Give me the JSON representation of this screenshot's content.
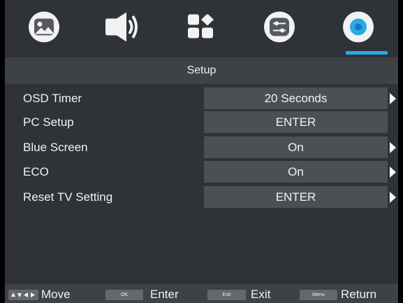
{
  "tabs": [
    {
      "name": "picture",
      "icon": "picture-icon"
    },
    {
      "name": "sound",
      "icon": "speaker-icon"
    },
    {
      "name": "channel",
      "icon": "channel-grid-icon"
    },
    {
      "name": "features",
      "icon": "sliders-icon"
    },
    {
      "name": "setup",
      "icon": "setup-gear-icon",
      "selected": true
    }
  ],
  "colors": {
    "accent": "#29a8e6",
    "background": "#2f3236",
    "title_bar": "#3e4146",
    "value_box": "#4c5055"
  },
  "title": "Setup",
  "menu": {
    "items": [
      {
        "label": "OSD Timer",
        "value": "20 Seconds",
        "has_arrow": true
      },
      {
        "label": "PC Setup",
        "value": "ENTER",
        "has_arrow": false
      },
      {
        "label": "Blue Screen",
        "value": "On",
        "has_arrow": true
      },
      {
        "label": "ECO",
        "value": "On",
        "has_arrow": true
      },
      {
        "label": "Reset TV Setting",
        "value": "ENTER",
        "has_arrow": true
      }
    ]
  },
  "help": {
    "move_label": "Move",
    "ok_key": "OK",
    "enter_label": "Enter",
    "exit_key": "Exit",
    "exit_label": "Exit",
    "menu_key": "Menu",
    "return_label": "Return"
  }
}
